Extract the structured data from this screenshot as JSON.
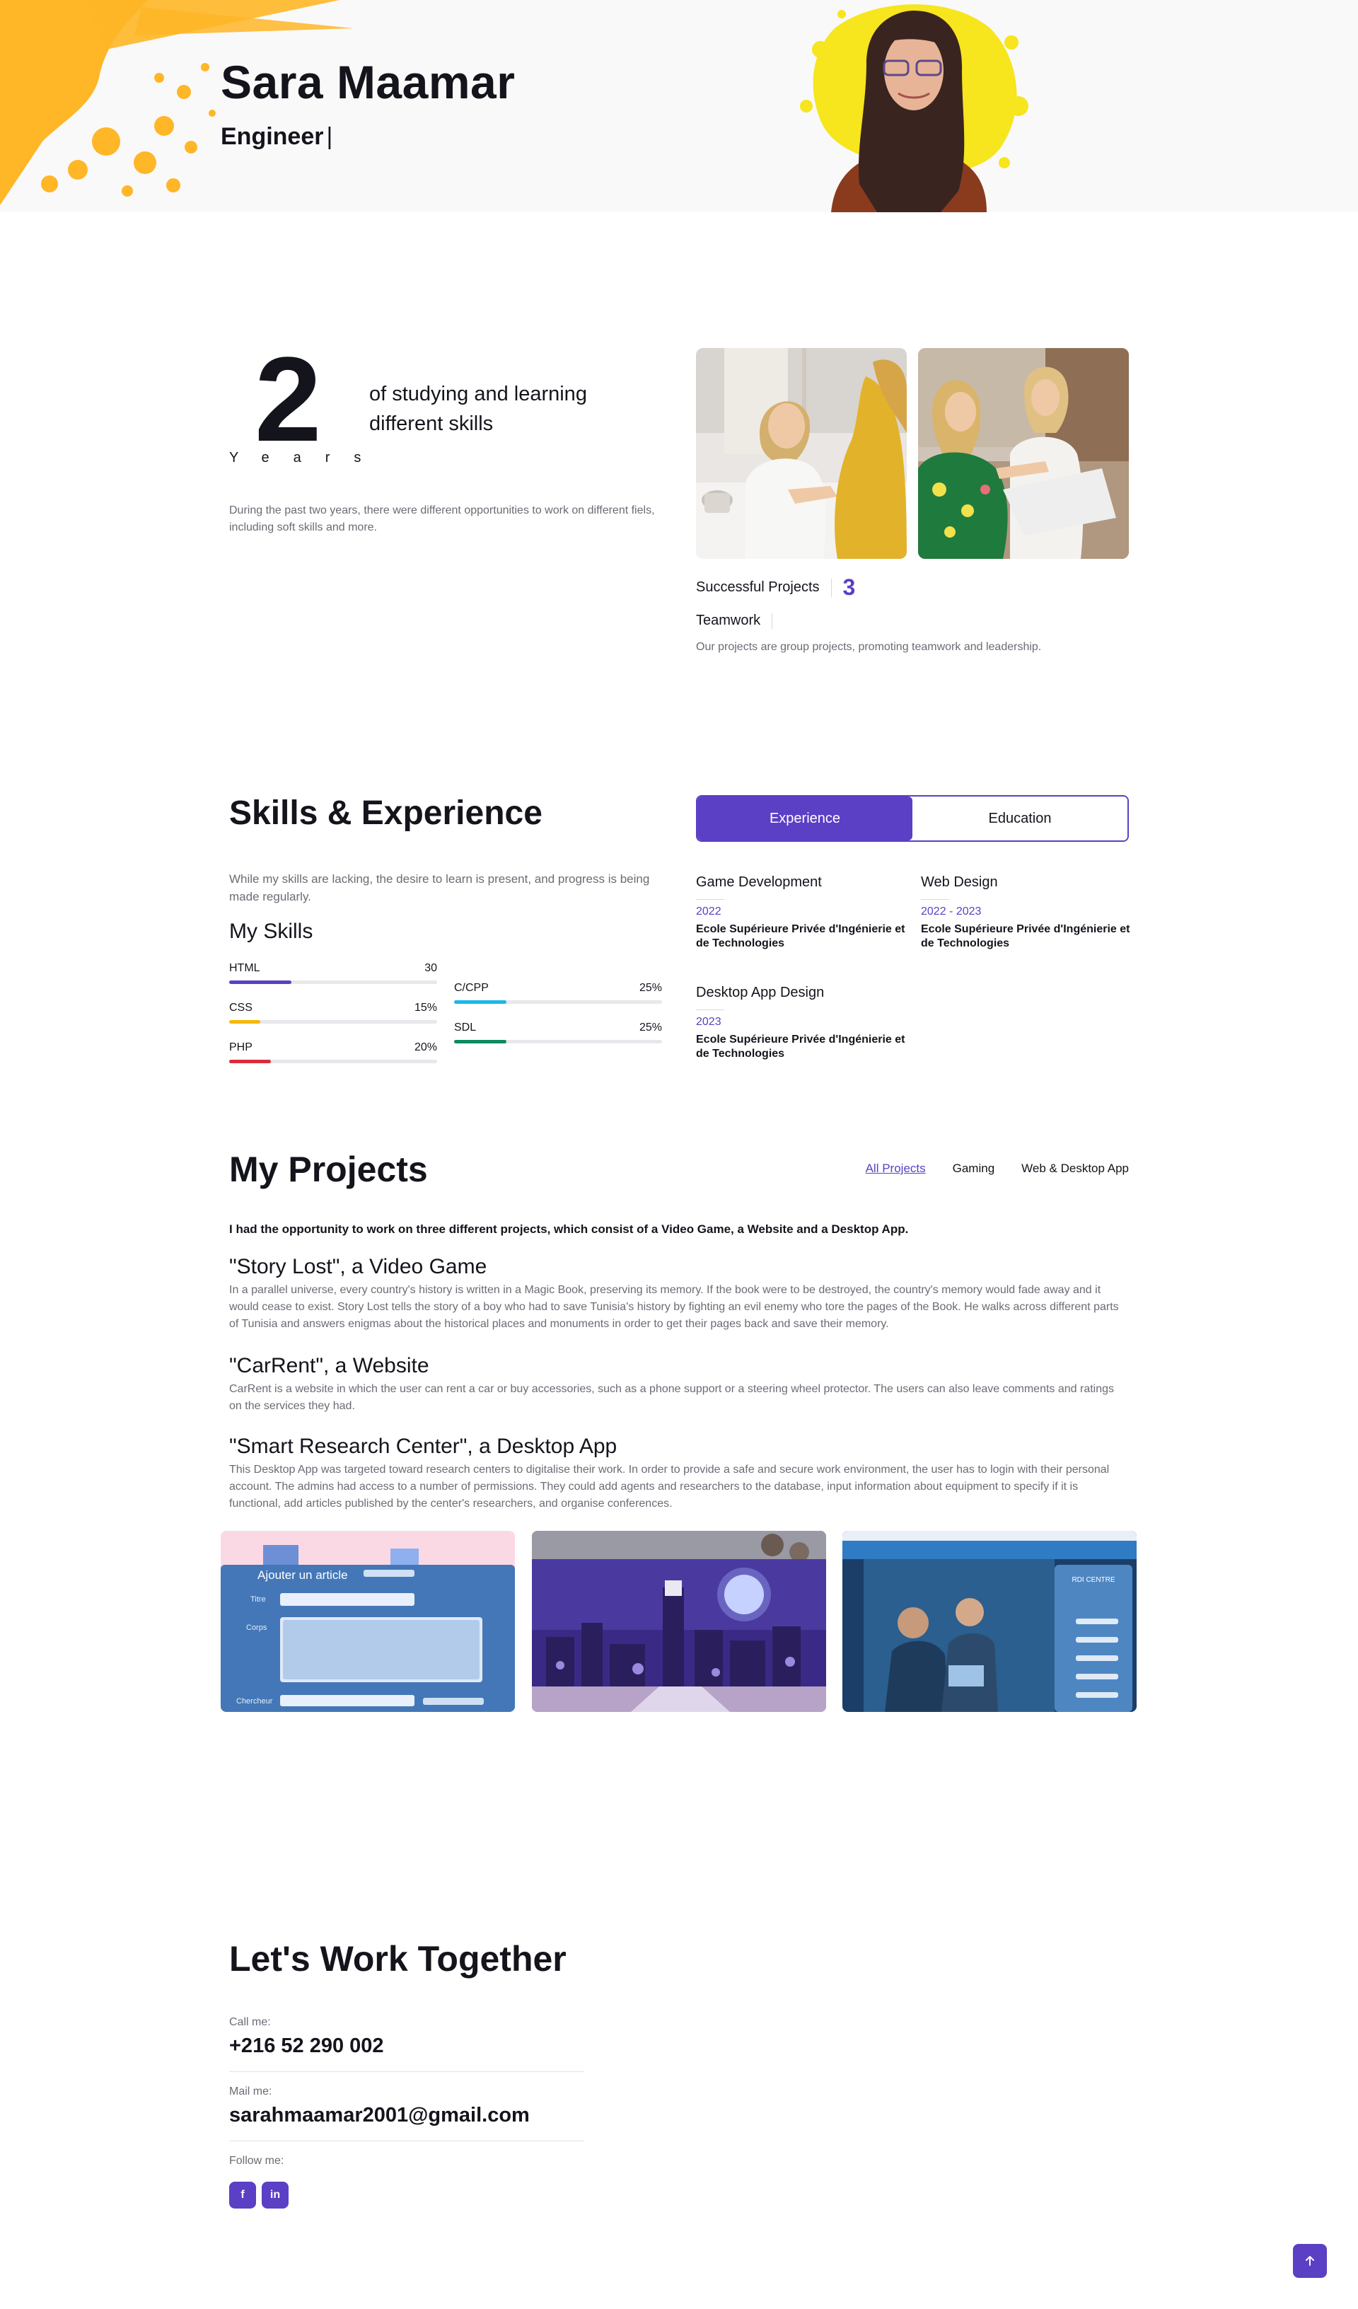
{
  "hero": {
    "name": "Sara Maamar",
    "role": "Engineer",
    "cursor": "|"
  },
  "about": {
    "years_number": "2",
    "years_word": "Years",
    "years_text": "of studying and learning different skills",
    "paragraph": "During the past two years, there were different opportunities to work on different fiels, including soft skills and more.",
    "successful_projects_label": "Successful Projects",
    "successful_projects_count": "3",
    "teamwork_label": "Teamwork",
    "teamwork_text": "Our projects are group projects, promoting teamwork and leadership."
  },
  "skills": {
    "title": "Skills & Experience",
    "paragraph": "While my skills are lacking, the desire to learn is present, and progress is being made regularly.",
    "my_skills_title": "My Skills",
    "items": [
      {
        "name": "HTML",
        "percent_label": "30",
        "value": 30,
        "color": "#5b3fc4"
      },
      {
        "name": "CSS",
        "percent_label": "15%",
        "value": 15,
        "color": "#f5b800"
      },
      {
        "name": "PHP",
        "percent_label": "20%",
        "value": 20,
        "color": "#dc2b3b"
      },
      {
        "name": "C/CPP",
        "percent_label": "25%",
        "value": 25,
        "color": "#18b8e8"
      },
      {
        "name": "SDL",
        "percent_label": "25%",
        "value": 25,
        "color": "#0f8a5f"
      }
    ],
    "tabs": [
      {
        "label": "Experience",
        "active": true
      },
      {
        "label": "Education",
        "active": false
      }
    ],
    "experience": [
      {
        "title": "Game Development",
        "year": "2022",
        "school": "Ecole Supérieure Privée d'Ingénierie et de Technologies"
      },
      {
        "title": "Web Design",
        "year": "2022 - 2023",
        "school": "Ecole Supérieure Privée d'Ingénierie et de Technologies"
      },
      {
        "title": "Desktop App Design",
        "year": "2023",
        "school": "Ecole Supérieure Privée d'Ingénierie et de Technologies"
      }
    ]
  },
  "projects": {
    "title": "My Projects",
    "filters": [
      {
        "label": "All Projects",
        "active": true
      },
      {
        "label": "Gaming",
        "active": false
      },
      {
        "label": "Web & Desktop App",
        "active": false
      }
    ],
    "intro": "I had the opportunity to work on three different projects, which consist of a Video Game, a Website and a Desktop App.",
    "items": [
      {
        "title": "\"Story Lost\", a Video Game",
        "text": "In a parallel universe, every country's history is written in a Magic Book, preserving its memory. If the book were to be destroyed, the country's memory would fade away and it would cease to exist. Story Lost tells the story of a boy who had to save Tunisia's history by fighting an evil enemy who tore the pages of the Book. He walks across different parts of Tunisia and answers enigmas about the historical places and monuments in order to get their pages back and save their memory."
      },
      {
        "title": "\"CarRent\", a Website",
        "text": "CarRent is a website in which the user can rent a car or buy accessories, such as a phone support or a steering wheel protector. The users can also leave comments and ratings on the services they had."
      },
      {
        "title": "\"Smart Research Center\", a Desktop App",
        "text": "This Desktop App was targeted toward research centers to digitalise their work. In order to provide a safe and secure work environment, the user has to login with their personal account. The admins had access to a number of permissions. They could add agents and researchers to the database, input information about equipment to specify if it is functional, add articles published by the center's researchers, and organise conferences."
      }
    ],
    "shot_form": {
      "heading": "Ajouter un article",
      "field_title": "Titre",
      "field_body": "Corps",
      "field_author": "Chercheur"
    },
    "shot_desktop": {
      "panel_label": "RDI CENTRE"
    }
  },
  "contact": {
    "title": "Let's Work Together",
    "call_label": "Call me:",
    "phone": "+216 52 290 002",
    "mail_label": "Mail me:",
    "email": "sarahmaamar2001@gmail.com",
    "follow_label": "Follow me:",
    "social": [
      {
        "name": "facebook",
        "glyph": "f"
      },
      {
        "name": "linkedin",
        "glyph": "in"
      }
    ]
  },
  "colors": {
    "accent": "#5b3fc4",
    "splash": "#ffb627",
    "portrait_splash": "#f7e51e"
  },
  "icons": {
    "back_to_top": "arrow-up-icon"
  }
}
